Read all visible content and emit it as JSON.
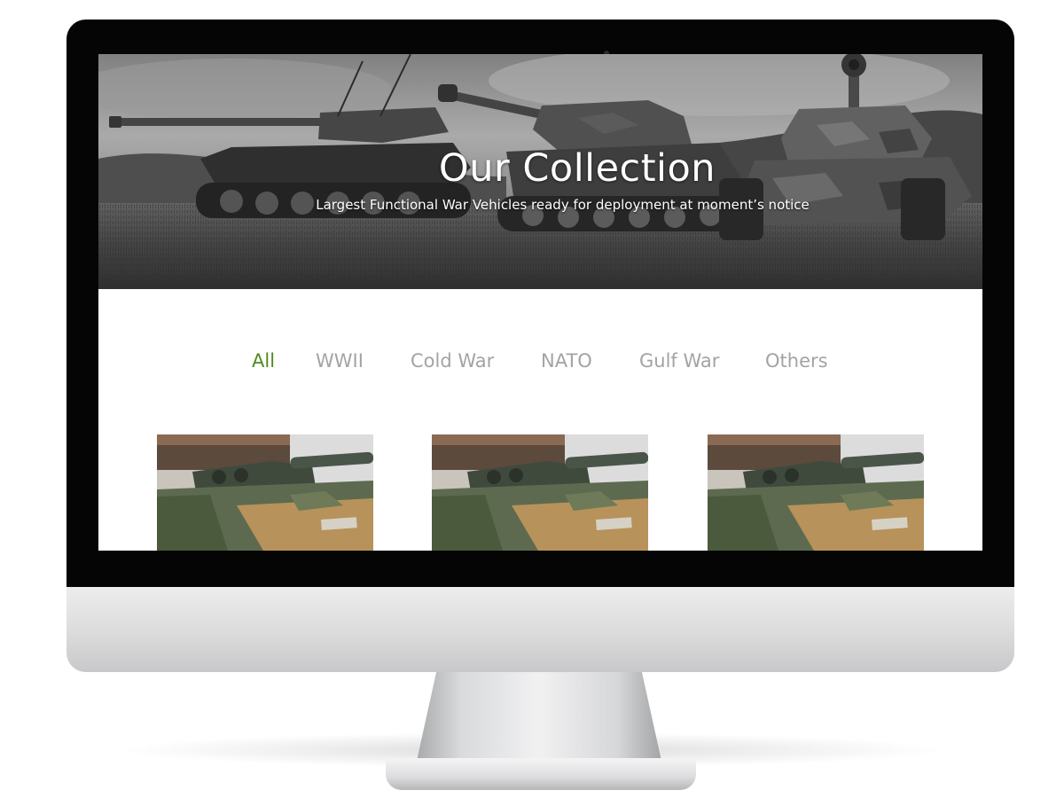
{
  "hero": {
    "title": "Our Collection",
    "subtitle": "Largest Functional War Vehicles ready for deployment at moment’s notice"
  },
  "filters": {
    "items": [
      {
        "label": "All",
        "active": true
      },
      {
        "label": "WWII",
        "active": false
      },
      {
        "label": "Cold War",
        "active": false
      },
      {
        "label": "NATO",
        "active": false
      },
      {
        "label": "Gulf War",
        "active": false
      },
      {
        "label": "Others",
        "active": false
      }
    ]
  },
  "gallery": {
    "items": [
      {
        "image": "tank-photo"
      },
      {
        "image": "tank-photo"
      },
      {
        "image": "tank-photo"
      }
    ]
  },
  "colors": {
    "active_filter": "#4f8a1f",
    "inactive_filter": "#a3a3a3",
    "bezel": "#050505",
    "screen_bg": "#ffffff"
  }
}
